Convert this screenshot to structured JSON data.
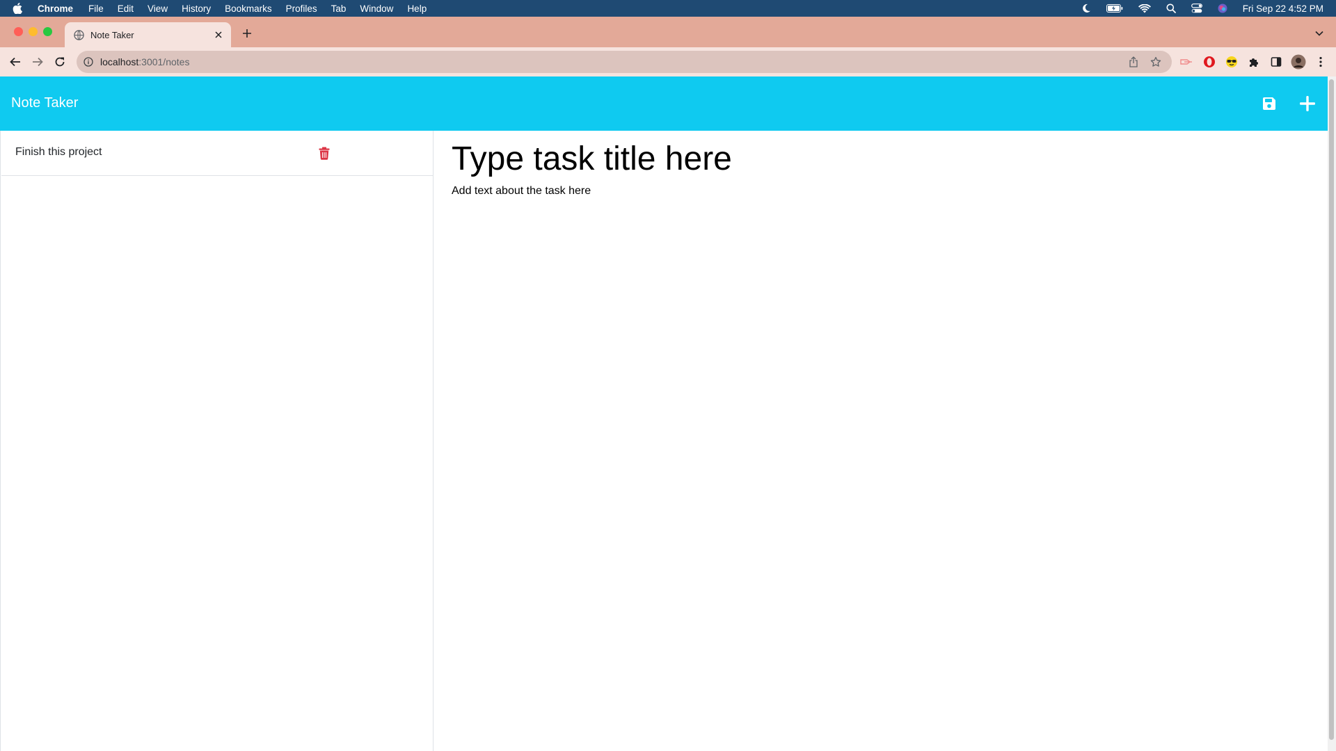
{
  "menubar": {
    "app_name": "Chrome",
    "items": [
      "File",
      "Edit",
      "View",
      "History",
      "Bookmarks",
      "Profiles",
      "Tab",
      "Window",
      "Help"
    ],
    "clock": "Fri Sep 22  4:52 PM",
    "status_icons": [
      "moon-icon",
      "battery-icon",
      "wifi-icon",
      "search-icon",
      "control-center-icon",
      "siri-icon"
    ]
  },
  "browser": {
    "tab_title": "Note Taker",
    "url_host": "localhost",
    "url_path": ":3001/notes",
    "colors": {
      "tabstrip": "#e3a998",
      "toolbar": "#f6e3de",
      "omnibox": "#dcc4be"
    }
  },
  "app": {
    "brand": "Note Taker",
    "navbar_color": "#0fcaf0",
    "actions": {
      "save_icon": "floppy-disk-icon",
      "new_icon": "plus-icon"
    },
    "notes": [
      {
        "title": "Finish this project"
      }
    ],
    "editor": {
      "title_placeholder": "Type task title here",
      "text_placeholder": "Add text about the task here"
    },
    "delete_color": "#dc3545"
  }
}
